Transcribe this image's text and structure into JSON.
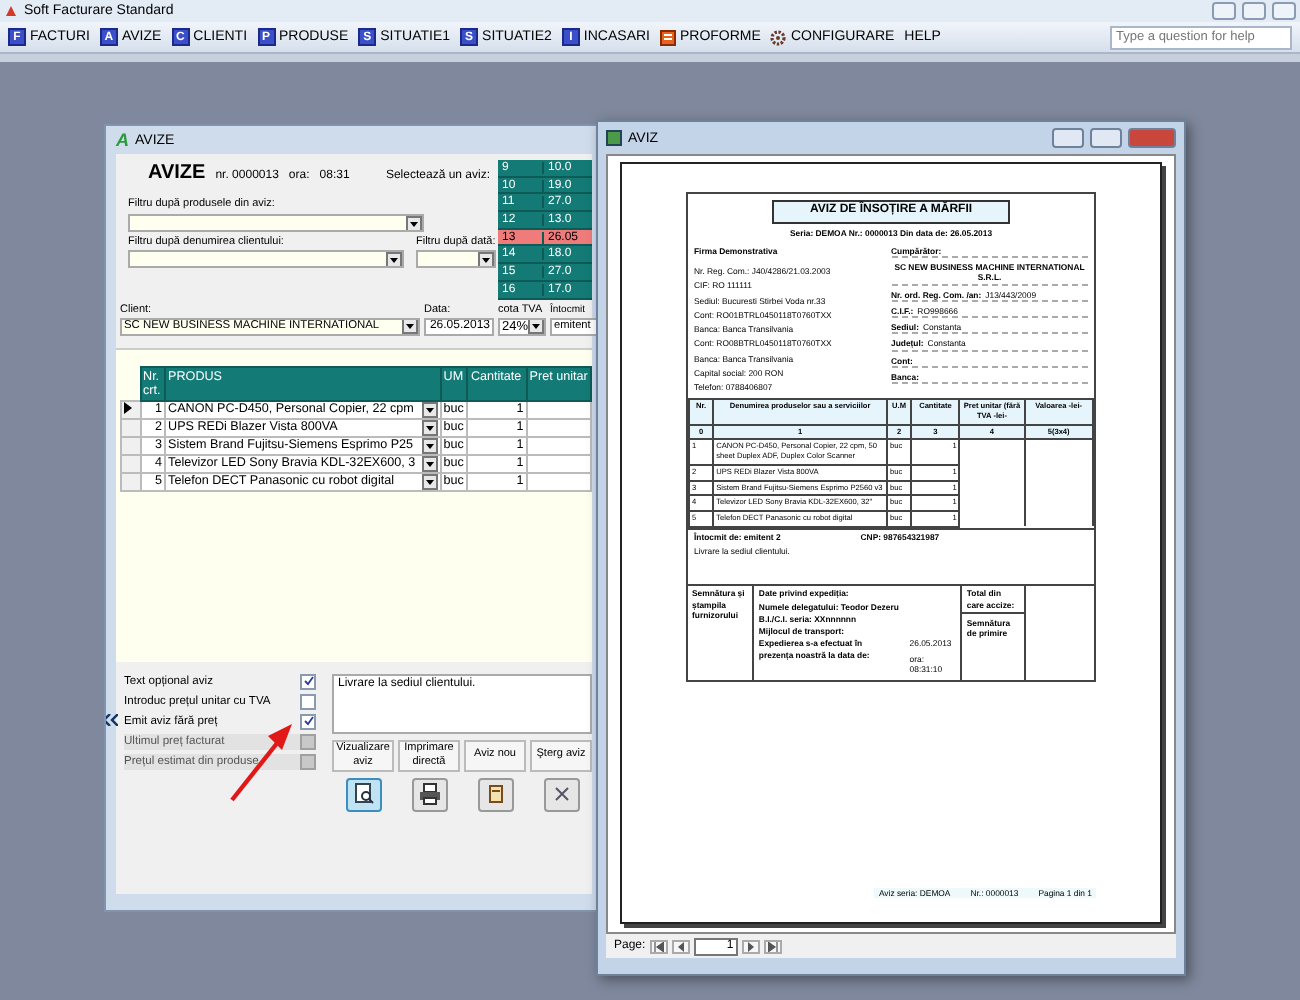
{
  "app": {
    "title": "Soft Facturare Standard"
  },
  "menu": {
    "items": [
      {
        "label": "FACTURI",
        "kind": "letter",
        "icon_text": "F"
      },
      {
        "label": "AVIZE",
        "kind": "letter",
        "icon_text": "A"
      },
      {
        "label": "CLIENTI",
        "kind": "letter",
        "icon_text": "C"
      },
      {
        "label": "PRODUSE",
        "kind": "letter",
        "icon_text": "P"
      },
      {
        "label": "SITUATIE1",
        "kind": "letter",
        "icon_text": "S"
      },
      {
        "label": "SITUATIE2",
        "kind": "letter",
        "icon_text": "S"
      },
      {
        "label": "INCASARI",
        "kind": "letter",
        "icon_text": "I"
      },
      {
        "label": "PROFORME",
        "kind": "doc"
      },
      {
        "label": "CONFIGURARE",
        "kind": "gear"
      },
      {
        "label": "HELP",
        "kind": "plain"
      }
    ],
    "help_search": {
      "placeholder": "Type a question for help"
    }
  },
  "avize_window": {
    "icon_text": "A",
    "title": "AVIZE",
    "heading": "AVIZE",
    "number": "nr. 0000013",
    "time_label": "ora:",
    "time": "08:31",
    "picker": {
      "label": "Selectează un aviz:",
      "rows": [
        {
          "number": "9",
          "date": "10.0",
          "selected": false
        },
        {
          "number": "10",
          "date": "19.0",
          "selected": false
        },
        {
          "number": "11",
          "date": "27.0",
          "selected": false
        },
        {
          "number": "12",
          "date": "13.0",
          "selected": false
        },
        {
          "number": "13",
          "date": "26.05",
          "selected": true
        },
        {
          "number": "14",
          "date": "18.0",
          "selected": false
        },
        {
          "number": "15",
          "date": "27.0",
          "selected": false
        },
        {
          "number": "16",
          "date": "17.0",
          "selected": false
        }
      ]
    },
    "filters": {
      "product_label": "Filtru după produsele din aviz:",
      "client_label": "Filtru după denumirea clientului:",
      "date_label": "Filtru după dată:"
    },
    "client": {
      "label": "Client:",
      "value": "SC NEW BUSINESS MACHINE INTERNATIONAL"
    },
    "date": {
      "label": "Data:",
      "value": "26.05.2013"
    },
    "vat": {
      "label": "cota TVA",
      "value": "24%"
    },
    "issuer": {
      "label": "Întocmit",
      "value": "emitent"
    },
    "table": {
      "columns": [
        "Nr. crt.",
        "PRODUS",
        "UM",
        "Cantitate",
        "Pret unitar"
      ],
      "rows": [
        {
          "nr": "1",
          "product": "CANON PC-D450, Personal Copier, 22 cpm",
          "um": "buc",
          "qty": "1",
          "selected": true
        },
        {
          "nr": "2",
          "product": "UPS REDi Blazer Vista 800VA",
          "um": "buc",
          "qty": "1",
          "selected": false
        },
        {
          "nr": "3",
          "product": "Sistem Brand Fujitsu-Siemens Esprimo P25",
          "um": "buc",
          "qty": "1",
          "selected": false
        },
        {
          "nr": "4",
          "product": "Televizor LED Sony Bravia KDL-32EX600, 3",
          "um": "buc",
          "qty": "1",
          "selected": false
        },
        {
          "nr": "5",
          "product": "Telefon DECT Panasonic cu robot digital",
          "um": "buc",
          "qty": "1",
          "selected": false
        }
      ]
    },
    "options": [
      {
        "label": "Text opțional aviz",
        "checked": true,
        "disabled": false
      },
      {
        "label": "Introduc prețul unitar cu TVA",
        "checked": false,
        "disabled": false
      },
      {
        "label": "Emit aviz fără preț",
        "checked": true,
        "disabled": false
      },
      {
        "label": "Ultimul preț facturat",
        "checked": false,
        "disabled": true
      },
      {
        "label": "Prețul estimat din produse",
        "checked": false,
        "disabled": true
      }
    ],
    "memo": "Livrare la sediul clientului.",
    "actions": [
      {
        "label": "Vizualizare aviz",
        "kind": "preview"
      },
      {
        "label": "Imprimare directă",
        "kind": "print"
      },
      {
        "label": "Aviz nou",
        "kind": "new"
      },
      {
        "label": "Şterg aviz",
        "kind": "delete"
      }
    ]
  },
  "preview_window": {
    "title": "AVIZ",
    "document": {
      "title": "AVIZ DE ÎNSOȚIRE A MĂRFII",
      "series_line": "Seria: DEMOA    Nr.: 0000013    Din data de: 26.05.2013",
      "supplier": [
        "Firma Demonstrativa",
        "Nr. Reg. Com.: J40/4286/21.03.2003",
        "CIF: RO 111111",
        "Sediul: Bucuresti Stirbei Voda nr.33",
        "Cont: RO01BTRL0450118T0760TXX",
        "Banca: Banca Transilvania",
        "Cont: RO08BTRL0450118T0760TXX",
        "Banca: Banca Transilvania",
        "Capital social: 200 RON",
        "Telefon: 0788406807"
      ],
      "buyer": [
        {
          "label": "Cumpărător:"
        },
        {
          "value": "SC NEW BUSINESS MACHINE INTERNATIONAL S.R.L."
        },
        {
          "label": "Nr. ord. Reg. Com. /an:",
          "value": "J13/443/2009"
        },
        {
          "label": "C.I.F.:",
          "value": "RO998666"
        },
        {
          "label": "Sediul:",
          "value": "Constanta"
        },
        {
          "label": "Județul:",
          "value": "Constanta"
        },
        {
          "label": "Cont:"
        },
        {
          "label": "Banca:"
        }
      ],
      "columns": [
        "Nr.",
        "Denumirea produselor sau a serviciilor",
        "U.M",
        "Cantitate",
        "Pret unitar (fără TVA -lei-",
        "Valoarea -lei-"
      ],
      "index_row": [
        "0",
        "1",
        "2",
        "3",
        "4",
        "5(3x4)"
      ],
      "rows": [
        {
          "nr": "1",
          "name": "CANON PC-D450, Personal Copier, 22 cpm, 50 sheet Duplex ADF, Duplex Color Scanner",
          "um": "buc",
          "qty": "1"
        },
        {
          "nr": "2",
          "name": "UPS REDi Blazer Vista 800VA",
          "um": "buc",
          "qty": "1"
        },
        {
          "nr": "3",
          "name": "Sistem Brand Fujitsu-Siemens Esprimo P2560 v3",
          "um": "buc",
          "qty": "1"
        },
        {
          "nr": "4",
          "name": "Televizor LED Sony Bravia KDL-32EX600, 32\"",
          "um": "buc",
          "qty": "1"
        },
        {
          "nr": "5",
          "name": "Telefon DECT Panasonic cu robot digital",
          "um": "buc",
          "qty": "1"
        }
      ],
      "issued_by": "Întocmit de:  emitent 2",
      "cnp": "CNP: 987654321987",
      "note": "Livrare la sediul clientului.",
      "signature_label": "Semnătura și ștampila furnizorului",
      "shipping": {
        "title": "Date privind expediția:",
        "lines": [
          "Numele delegatului:   Teodor Dezeru",
          "B.I./C.I. seria:  XXnnnnnn",
          "Mijlocul de transport:"
        ],
        "statement": "Expedierea s-a efectuat în prezența noastră la data de:",
        "date": "26.05.2013",
        "time": "ora: 08:31:10"
      },
      "total_label": "Total din care accize:",
      "receipt_label": "Semnătura de primire",
      "footer": [
        "Aviz seria:   DEMOA",
        "Nr.:  0000013",
        "Pagina 1 din 1"
      ]
    },
    "pager": {
      "label": "Page:",
      "page": "1"
    }
  }
}
